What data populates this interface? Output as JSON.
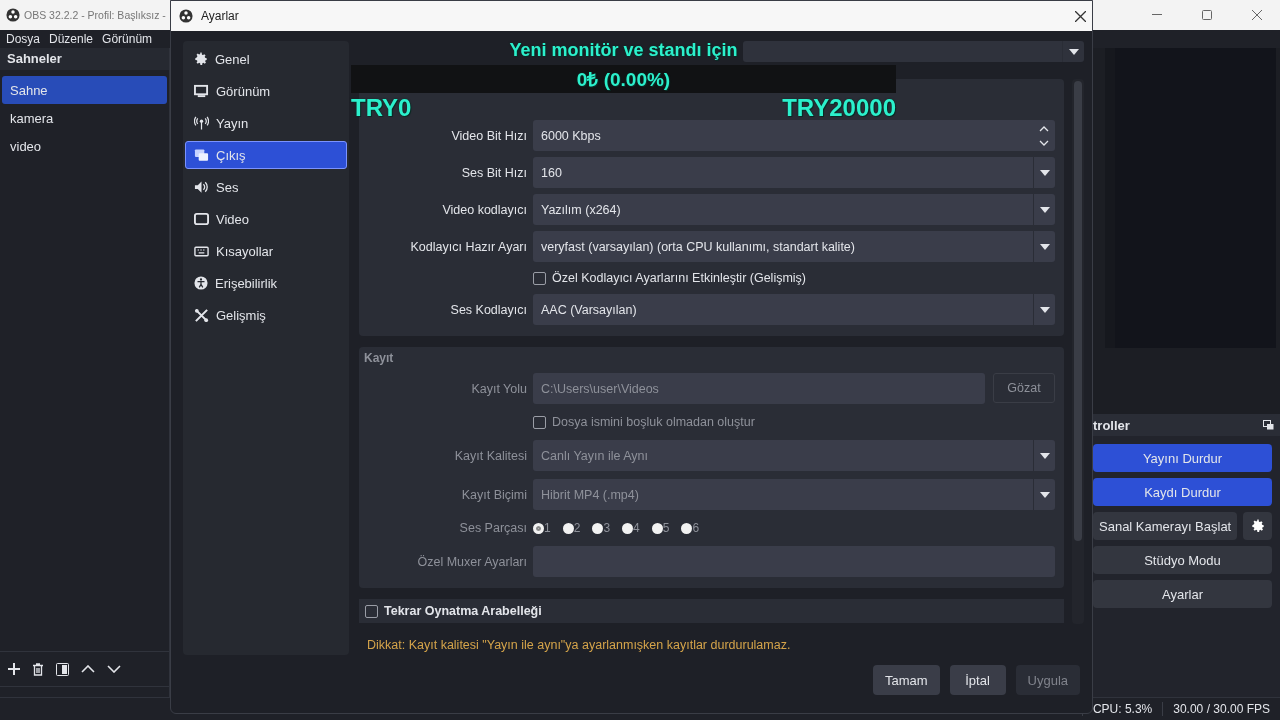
{
  "main_window": {
    "title": "OBS 32.2.2 - Profil: Başlıksız -",
    "menu": [
      "Dosya",
      "Düzenle",
      "Görünüm"
    ]
  },
  "scenes": {
    "title": "Sahneler",
    "items": [
      {
        "label": "Sahne",
        "selected": true
      },
      {
        "label": "kamera",
        "selected": false
      },
      {
        "label": "video",
        "selected": false
      }
    ]
  },
  "controls": {
    "title": "troller",
    "buttons": [
      {
        "label": "Yayını Durdur",
        "active": true,
        "kind": "plain"
      },
      {
        "label": "Kaydı Durdur",
        "active": true,
        "kind": "plain"
      },
      {
        "label": "Sanal Kamerayı Başlat",
        "active": false,
        "kind": "with_settings"
      },
      {
        "label": "Stüdyo Modu",
        "active": false,
        "kind": "plain"
      },
      {
        "label": "Ayarlar",
        "active": false,
        "kind": "plain"
      }
    ]
  },
  "status_bar": {
    "cpu": "CPU: 5.3%",
    "fps": "30.00 / 30.00 FPS"
  },
  "dialog": {
    "title": "Ayarlar",
    "nav": [
      {
        "label": "Genel",
        "selected": false
      },
      {
        "label": "Görünüm",
        "selected": false
      },
      {
        "label": "Yayın",
        "selected": false
      },
      {
        "label": "Çıkış",
        "selected": true
      },
      {
        "label": "Ses",
        "selected": false
      },
      {
        "label": "Video",
        "selected": false
      },
      {
        "label": "Kısayollar",
        "selected": false
      },
      {
        "label": "Erişebilirlik",
        "selected": false
      },
      {
        "label": "Gelişmiş",
        "selected": false
      }
    ],
    "stream": {
      "rows": [
        {
          "kind": "spin",
          "label": "Video Bit Hızı",
          "value": "6000 Kbps"
        },
        {
          "kind": "combo",
          "label": "Ses Bit Hızı",
          "value": "160"
        },
        {
          "kind": "combo",
          "label": "Video kodlayıcı",
          "value": "Yazılım (x264)"
        },
        {
          "kind": "combo",
          "label": "Kodlayıcı Hazır Ayarı",
          "value": "veryfast (varsayılan) (orta CPU kullanımı, standart kalite)"
        },
        {
          "kind": "check",
          "label": "Özel Kodlayıcı Ayarlarını Etkinleştir (Gelişmiş)",
          "checked": false
        },
        {
          "kind": "combo",
          "label": "Ses Kodlayıcı",
          "value": "AAC (Varsayılan)"
        }
      ]
    },
    "recording": {
      "title": "Kayıt",
      "disabled": true,
      "rows": [
        {
          "kind": "path",
          "label": "Kayıt Yolu",
          "value": "C:\\Users\\user\\Videos",
          "button": "Gözat"
        },
        {
          "kind": "check",
          "label": "Dosya ismini boşluk olmadan oluştur",
          "checked": false
        },
        {
          "kind": "combo",
          "label": "Kayıt Kalitesi",
          "value": "Canlı Yayın ile Aynı"
        },
        {
          "kind": "combo",
          "label": "Kayıt Biçimi",
          "value": "Hibrit MP4 (.mp4)"
        },
        {
          "kind": "radios",
          "label": "Ses Parçası",
          "options": [
            {
              "label": "1",
              "selected": true
            },
            {
              "label": "2",
              "selected": false
            },
            {
              "label": "3",
              "selected": false
            },
            {
              "label": "4",
              "selected": false
            },
            {
              "label": "5",
              "selected": false
            },
            {
              "label": "6",
              "selected": false
            }
          ]
        },
        {
          "kind": "text",
          "label": "Özel Muxer Ayarları"
        }
      ]
    },
    "replay_buffer": {
      "label": "Tekrar Oynatma Arabelleği",
      "checked": false
    },
    "warning": "Dikkat: Kayıt kalitesi \"Yayın ile aynı\"ya ayarlanmışken kayıtlar durdurulamaz.",
    "buttons": [
      {
        "label": "Tamam",
        "disabled": false
      },
      {
        "label": "İptal",
        "disabled": false
      },
      {
        "label": "Uygula",
        "disabled": true
      }
    ]
  },
  "overlay": {
    "title": "Yeni monitör ve standı için",
    "amount": "0₺ (0.00%)",
    "level": 0,
    "min": "TRY0",
    "max": "TRY20000"
  }
}
